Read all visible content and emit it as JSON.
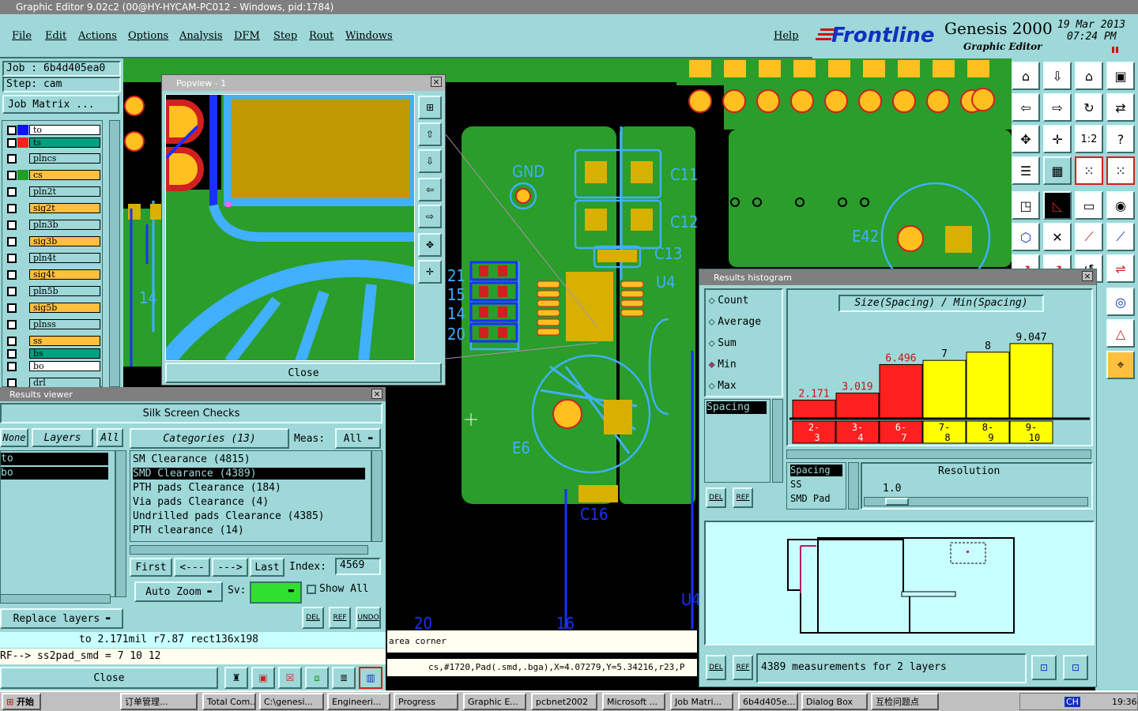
{
  "window_title": "Graphic Editor 9.02c2 (00@HY-HYCAM-PC012 - Windows, pid:1784)",
  "menu": {
    "file": "File",
    "edit": "Edit",
    "actions": "Actions",
    "options": "Options",
    "analysis": "Analysis",
    "dfm": "DFM",
    "step": "Step",
    "rout": "Rout",
    "windows": "Windows",
    "help": "Help"
  },
  "brand": {
    "logo": "Frontline",
    "product": "Genesis 2000",
    "subtitle": "Graphic Editor",
    "date": "19 Mar 2013",
    "time": "07:24 PM"
  },
  "left": {
    "job": "Job : 6b4d405ea0",
    "step": "Step: cam",
    "job_matrix": "Job Matrix ...",
    "layers": [
      {
        "name": "to",
        "color": "#ffffff",
        "chip": "#1010ff"
      },
      {
        "name": "ts",
        "color": "#00a080",
        "chip": "#ff2020"
      },
      {
        "name": "plncs",
        "color": "#9ed8d8",
        "chip": "#9ed8d8"
      },
      {
        "name": "cs",
        "color": "#ffc040",
        "chip": "#20a020"
      },
      {
        "name": "pln2t",
        "color": "#9ed8d8",
        "chip": "#9ed8d8"
      },
      {
        "name": "sig2t",
        "color": "#ffc040",
        "chip": "#9ed8d8"
      },
      {
        "name": "pln3b",
        "color": "#9ed8d8",
        "chip": "#9ed8d8"
      },
      {
        "name": "sig3b",
        "color": "#ffc040",
        "chip": "#9ed8d8"
      },
      {
        "name": "pln4t",
        "color": "#9ed8d8",
        "chip": "#9ed8d8"
      },
      {
        "name": "sig4t",
        "color": "#ffc040",
        "chip": "#9ed8d8"
      },
      {
        "name": "pln5b",
        "color": "#9ed8d8",
        "chip": "#9ed8d8"
      },
      {
        "name": "sig5b",
        "color": "#ffc040",
        "chip": "#9ed8d8"
      },
      {
        "name": "plnss",
        "color": "#9ed8d8",
        "chip": "#9ed8d8"
      },
      {
        "name": "ss",
        "color": "#ffc040",
        "chip": "#9ed8d8"
      },
      {
        "name": "bs",
        "color": "#00a080",
        "chip": "#9ed8d8"
      },
      {
        "name": "bo",
        "color": "#ffffff",
        "chip": "#9ed8d8"
      },
      {
        "name": "drl",
        "color": "#9ed8d8",
        "chip": "#9ed8d8"
      }
    ]
  },
  "popview": {
    "title": "Popview - 1",
    "close": "Close"
  },
  "results_viewer": {
    "title": "Results viewer",
    "header": "Silk Screen Checks",
    "none": "None",
    "layers": "Layers",
    "all": "All",
    "categories": "Categories (13)",
    "meas_label": "Meas:",
    "meas_value": "All",
    "layer_items": [
      "to",
      "bo"
    ],
    "category_items": [
      "SM Clearance (4815)",
      "SMD Clearance (4389)",
      "PTH pads Clearance (184)",
      "Via pads Clearance (4)",
      "Undrilled pads Clearance (4385)",
      "PTH clearance (14)"
    ],
    "first": "First",
    "prev": "<---",
    "next": "--->",
    "last": "Last",
    "index_label": "Index:",
    "index_value": "4569",
    "auto_zoom": "Auto Zoom",
    "sv": "Sv:",
    "show_all": "Show All",
    "replace_layers": "Replace layers",
    "del": "DEL",
    "ref": "REF",
    "undo": "UNDO",
    "status_line": "to 2.171mil r7.87 rect136x198",
    "ref_line": "RF--> ss2pad_smd = 7 10 12",
    "close": "Close"
  },
  "canvas_labels": {
    "gnd": "GND",
    "c11": "C11",
    "c12": "C12",
    "c13": "C13",
    "u4": "U4",
    "e42": "E42",
    "e6": "E6",
    "c16": "C16",
    "n14": "14",
    "n15": "15",
    "n20": "20",
    "n21": "21",
    "u4b": "U4",
    "n20b": "20",
    "n16": "16"
  },
  "status": {
    "hint": "area corner",
    "coords": "cs,#1720,Pad(.smd,.bga),X=4.07279,Y=5.34216,r23,P"
  },
  "histogram": {
    "title": "Results histogram",
    "modes": [
      {
        "label": "Count",
        "selected": false
      },
      {
        "label": "Average",
        "selected": false
      },
      {
        "label": "Sum",
        "selected": false
      },
      {
        "label": "Min",
        "selected": true
      },
      {
        "label": "Max",
        "selected": false
      }
    ],
    "list_item": "Spacing",
    "chart_title": "Size(Spacing) / Min(Spacing)",
    "measure_list": [
      "Spacing",
      "SS",
      "SMD Pad"
    ],
    "resolution_label": "Resolution",
    "resolution_value": "1.0",
    "footer": "4389 measurements for 2 layers",
    "del": "DEL",
    "ref": "REF"
  },
  "chart_data": {
    "type": "bar",
    "title": "Size(Spacing) / Min(Spacing)",
    "categories": [
      "2-3",
      "3-4",
      "6-7",
      "7-8",
      "8-9",
      "9-10"
    ],
    "category_lines": [
      [
        "2-",
        "3"
      ],
      [
        "3-",
        "4"
      ],
      [
        "6-",
        "7"
      ],
      [
        "7-",
        "8"
      ],
      [
        "8-",
        "9"
      ],
      [
        "9-",
        "10"
      ]
    ],
    "values": [
      2.171,
      3.019,
      6.496,
      7,
      8,
      9.047
    ],
    "value_labels": [
      "2.171",
      "3.019",
      "6.496",
      "7",
      "8",
      "9.047"
    ],
    "colors": [
      "#ff2020",
      "#ff2020",
      "#ff2020",
      "#ffff00",
      "#ffff00",
      "#ffff00"
    ],
    "ylim": [
      0,
      10
    ],
    "grid": false
  },
  "taskbar": {
    "start": "开始",
    "items": [
      "订单管理...",
      "Total Com...",
      "C:\\genesi...",
      "Engineeri...",
      "Progress",
      "Graphic E...",
      "pcbnet2002",
      "Microsoft ...",
      "Job Matri...",
      "6b4d405e...",
      "Dialog Box",
      "互检问题点"
    ],
    "lang": "CH",
    "clock": "19:36"
  }
}
